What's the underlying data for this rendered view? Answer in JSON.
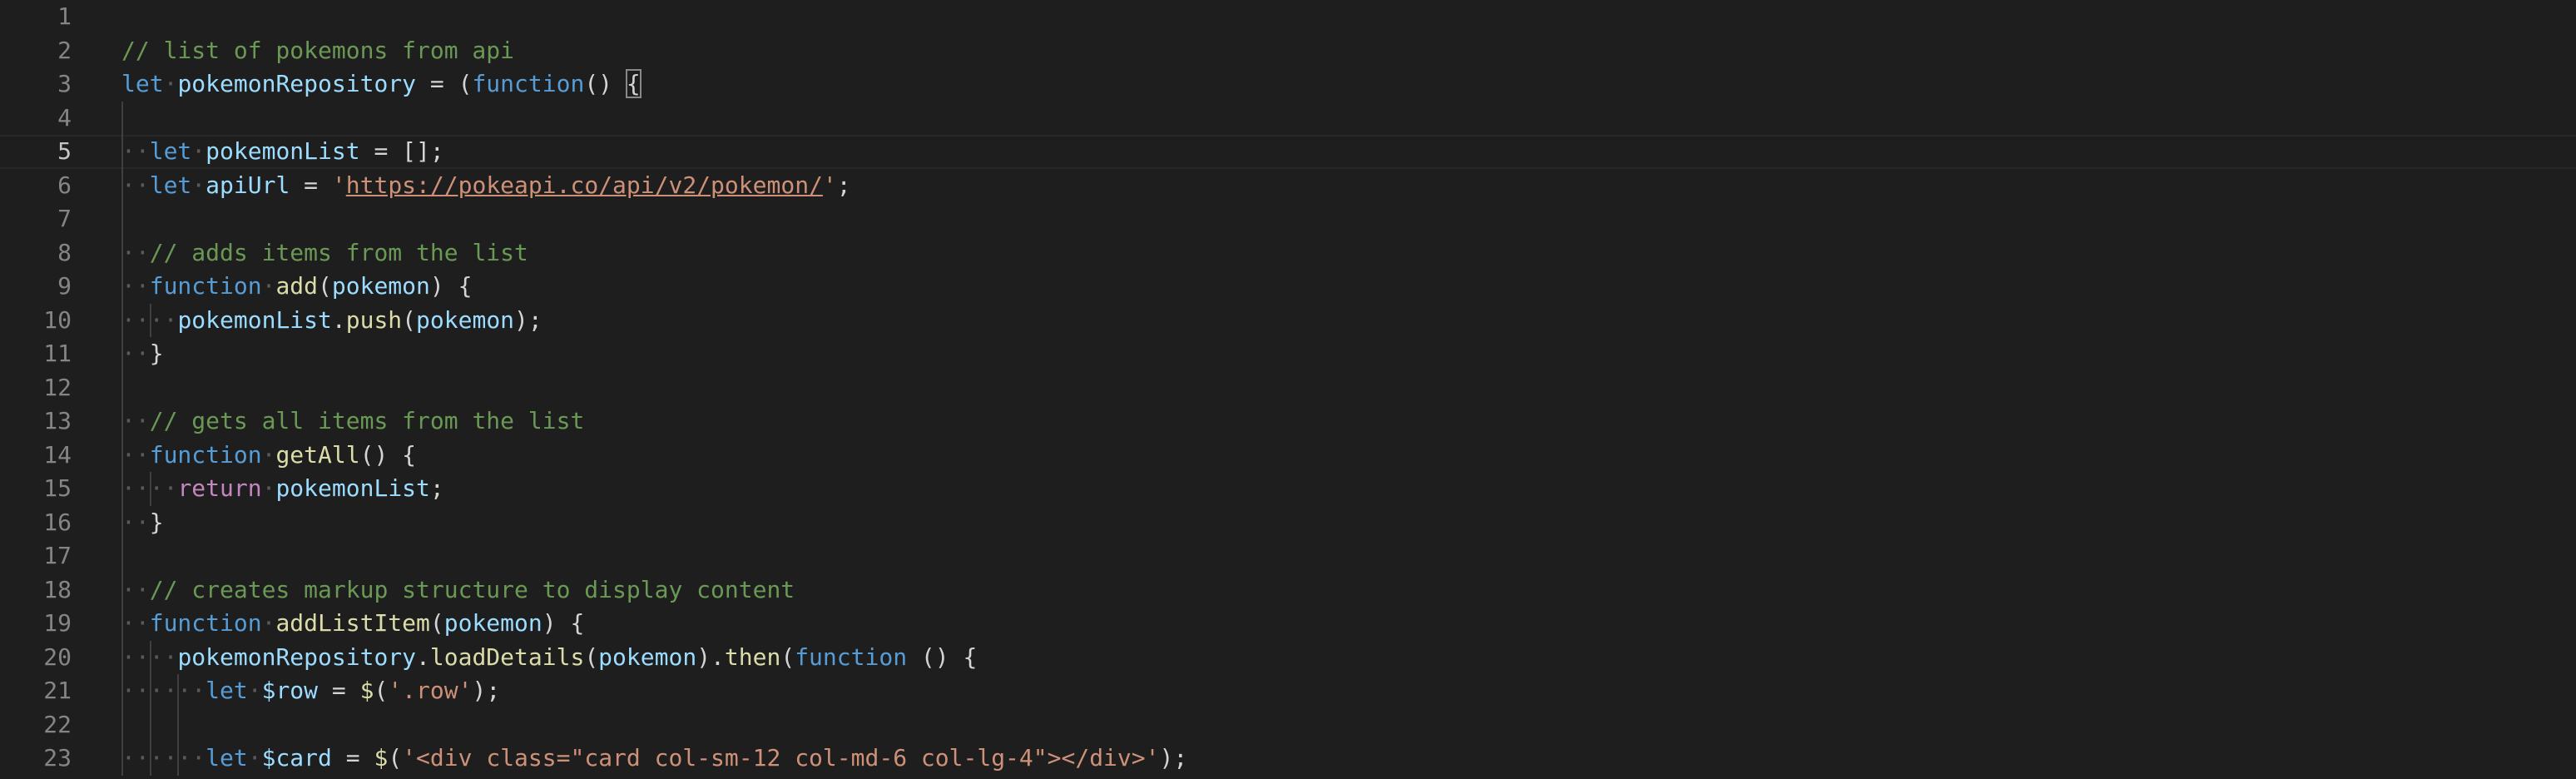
{
  "editor": {
    "current_line": 5,
    "colors": {
      "background": "#1e1e1e",
      "comment": "#6a9955",
      "keyword": "#569cd6",
      "control": "#c586c0",
      "variable": "#9cdcfe",
      "function": "#dcdcaa",
      "string": "#ce9178",
      "line_number": "#858585"
    },
    "lines": [
      {
        "number": "1",
        "indent": 0,
        "tokens": []
      },
      {
        "number": "2",
        "indent": 0,
        "tokens": [
          {
            "t": "// list of pokemons from api",
            "c": "comment"
          }
        ]
      },
      {
        "number": "3",
        "indent": 0,
        "tokens": [
          {
            "t": "let",
            "c": "keyword"
          },
          {
            "t": " ",
            "c": "ws"
          },
          {
            "t": "pokemonRepository",
            "c": "var"
          },
          {
            "t": " = (",
            "c": "punct"
          },
          {
            "t": "function",
            "c": "keyword"
          },
          {
            "t": "() ",
            "c": "punct"
          },
          {
            "t": "{",
            "c": "bracket"
          }
        ]
      },
      {
        "number": "4",
        "indent": 1,
        "tokens": []
      },
      {
        "number": "5",
        "indent": 1,
        "tokens": [
          {
            "t": "  ",
            "c": "ws"
          },
          {
            "t": "let",
            "c": "keyword"
          },
          {
            "t": " ",
            "c": "ws"
          },
          {
            "t": "pokemonList",
            "c": "var"
          },
          {
            "t": " = [];",
            "c": "punct"
          }
        ]
      },
      {
        "number": "6",
        "indent": 1,
        "tokens": [
          {
            "t": "  ",
            "c": "ws"
          },
          {
            "t": "let",
            "c": "keyword"
          },
          {
            "t": " ",
            "c": "ws"
          },
          {
            "t": "apiUrl",
            "c": "var"
          },
          {
            "t": " = ",
            "c": "punct"
          },
          {
            "t": "'",
            "c": "string"
          },
          {
            "t": "https://pokeapi.co/api/v2/pokemon/",
            "c": "link"
          },
          {
            "t": "'",
            "c": "string"
          },
          {
            "t": ";",
            "c": "punct"
          }
        ]
      },
      {
        "number": "7",
        "indent": 1,
        "tokens": []
      },
      {
        "number": "8",
        "indent": 1,
        "tokens": [
          {
            "t": "  ",
            "c": "ws"
          },
          {
            "t": "// adds items from the list",
            "c": "comment"
          }
        ]
      },
      {
        "number": "9",
        "indent": 1,
        "tokens": [
          {
            "t": "  ",
            "c": "ws"
          },
          {
            "t": "function",
            "c": "keyword"
          },
          {
            "t": " ",
            "c": "ws"
          },
          {
            "t": "add",
            "c": "func"
          },
          {
            "t": "(",
            "c": "punct"
          },
          {
            "t": "pokemon",
            "c": "var"
          },
          {
            "t": ") {",
            "c": "punct"
          }
        ]
      },
      {
        "number": "10",
        "indent": 2,
        "tokens": [
          {
            "t": "    ",
            "c": "ws"
          },
          {
            "t": "pokemonList",
            "c": "var"
          },
          {
            "t": ".",
            "c": "punct"
          },
          {
            "t": "push",
            "c": "func"
          },
          {
            "t": "(",
            "c": "punct"
          },
          {
            "t": "pokemon",
            "c": "var"
          },
          {
            "t": ");",
            "c": "punct"
          }
        ]
      },
      {
        "number": "11",
        "indent": 1,
        "tokens": [
          {
            "t": "  ",
            "c": "ws"
          },
          {
            "t": "}",
            "c": "punct"
          }
        ]
      },
      {
        "number": "12",
        "indent": 1,
        "tokens": []
      },
      {
        "number": "13",
        "indent": 1,
        "tokens": [
          {
            "t": "  ",
            "c": "ws"
          },
          {
            "t": "// gets all items from the list",
            "c": "comment"
          }
        ]
      },
      {
        "number": "14",
        "indent": 1,
        "tokens": [
          {
            "t": "  ",
            "c": "ws"
          },
          {
            "t": "function",
            "c": "keyword"
          },
          {
            "t": " ",
            "c": "ws"
          },
          {
            "t": "getAll",
            "c": "func"
          },
          {
            "t": "() {",
            "c": "punct"
          }
        ]
      },
      {
        "number": "15",
        "indent": 2,
        "tokens": [
          {
            "t": "    ",
            "c": "ws"
          },
          {
            "t": "return",
            "c": "control"
          },
          {
            "t": " ",
            "c": "ws"
          },
          {
            "t": "pokemonList",
            "c": "var"
          },
          {
            "t": ";",
            "c": "punct"
          }
        ]
      },
      {
        "number": "16",
        "indent": 1,
        "tokens": [
          {
            "t": "  ",
            "c": "ws"
          },
          {
            "t": "}",
            "c": "punct"
          }
        ]
      },
      {
        "number": "17",
        "indent": 1,
        "tokens": []
      },
      {
        "number": "18",
        "indent": 1,
        "tokens": [
          {
            "t": "  ",
            "c": "ws"
          },
          {
            "t": "// creates markup structure to display content",
            "c": "comment"
          }
        ]
      },
      {
        "number": "19",
        "indent": 1,
        "tokens": [
          {
            "t": "  ",
            "c": "ws"
          },
          {
            "t": "function",
            "c": "keyword"
          },
          {
            "t": " ",
            "c": "ws"
          },
          {
            "t": "addListItem",
            "c": "func"
          },
          {
            "t": "(",
            "c": "punct"
          },
          {
            "t": "pokemon",
            "c": "var"
          },
          {
            "t": ") {",
            "c": "punct"
          }
        ]
      },
      {
        "number": "20",
        "indent": 2,
        "tokens": [
          {
            "t": "    ",
            "c": "ws"
          },
          {
            "t": "pokemonRepository",
            "c": "var"
          },
          {
            "t": ".",
            "c": "punct"
          },
          {
            "t": "loadDetails",
            "c": "func"
          },
          {
            "t": "(",
            "c": "punct"
          },
          {
            "t": "pokemon",
            "c": "var"
          },
          {
            "t": ").",
            "c": "punct"
          },
          {
            "t": "then",
            "c": "func"
          },
          {
            "t": "(",
            "c": "punct"
          },
          {
            "t": "function",
            "c": "keyword"
          },
          {
            "t": " () {",
            "c": "punct"
          }
        ]
      },
      {
        "number": "21",
        "indent": 3,
        "tokens": [
          {
            "t": "      ",
            "c": "ws"
          },
          {
            "t": "let",
            "c": "keyword"
          },
          {
            "t": " ",
            "c": "ws"
          },
          {
            "t": "$row",
            "c": "var"
          },
          {
            "t": " = ",
            "c": "punct"
          },
          {
            "t": "$",
            "c": "func"
          },
          {
            "t": "(",
            "c": "punct"
          },
          {
            "t": "'.row'",
            "c": "string"
          },
          {
            "t": ");",
            "c": "punct"
          }
        ]
      },
      {
        "number": "22",
        "indent": 3,
        "tokens": []
      },
      {
        "number": "23",
        "indent": 3,
        "tokens": [
          {
            "t": "      ",
            "c": "ws"
          },
          {
            "t": "let",
            "c": "keyword"
          },
          {
            "t": " ",
            "c": "ws"
          },
          {
            "t": "$card",
            "c": "var"
          },
          {
            "t": " = ",
            "c": "punct"
          },
          {
            "t": "$",
            "c": "func"
          },
          {
            "t": "(",
            "c": "punct"
          },
          {
            "t": "'<div class=\"card col-sm-12 col-md-6 col-lg-4\"></div>'",
            "c": "string"
          },
          {
            "t": ");",
            "c": "punct"
          }
        ]
      }
    ]
  }
}
